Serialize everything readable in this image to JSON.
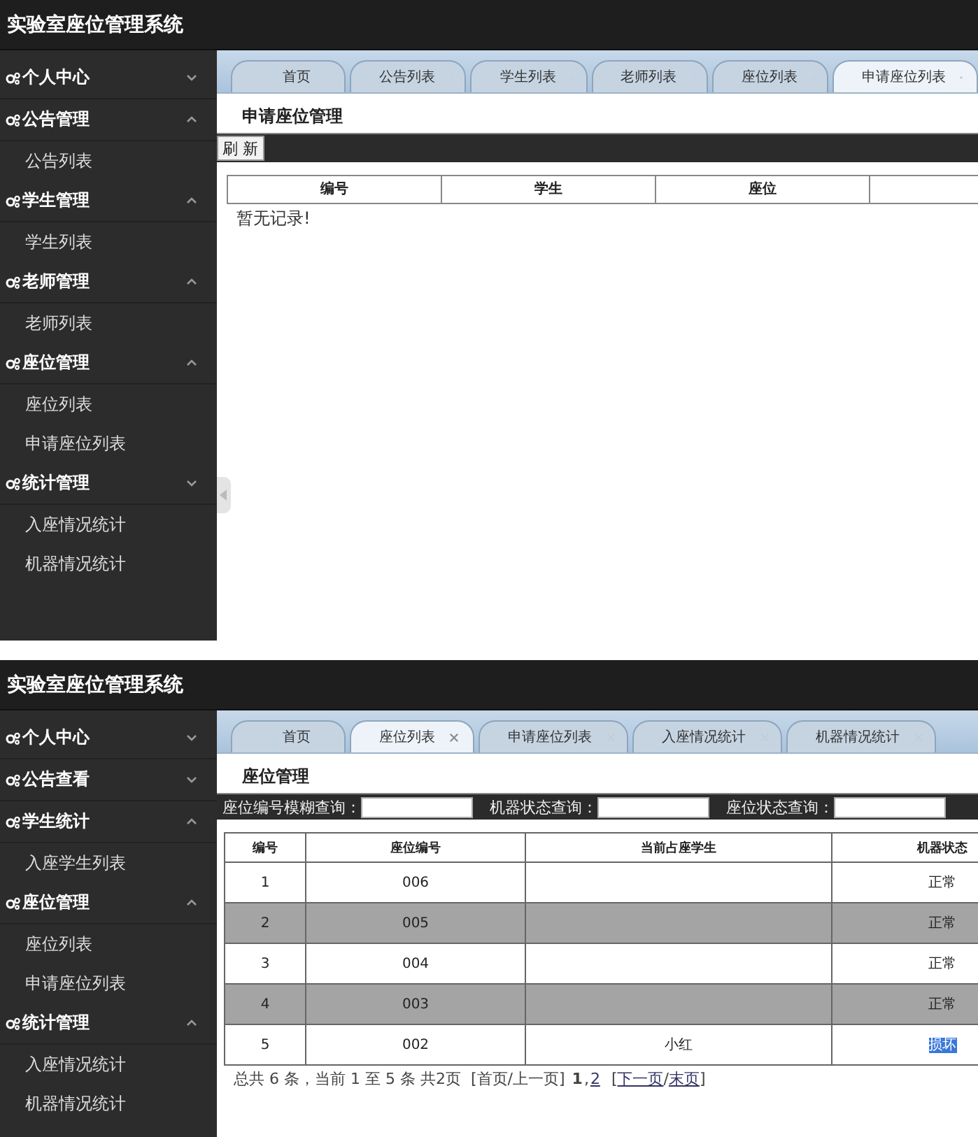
{
  "screens": [
    {
      "kind": "apply",
      "title": "实验室座位管理系统",
      "sidebar": [
        {
          "label": "个人中心",
          "expanded": false
        },
        {
          "label": "公告管理",
          "expanded": true,
          "children": [
            "公告列表"
          ]
        },
        {
          "label": "学生管理",
          "expanded": true,
          "children": [
            "学生列表"
          ]
        },
        {
          "label": "老师管理",
          "expanded": true,
          "children": [
            "老师列表"
          ]
        },
        {
          "label": "座位管理",
          "expanded": true,
          "children": [
            "座位列表",
            "申请座位列表"
          ]
        },
        {
          "label": "统计管理",
          "expanded": false,
          "children": [
            "入座情况统计",
            "机器情况统计"
          ]
        }
      ],
      "tabs": [
        {
          "label": "首页",
          "closable": false,
          "selected": false
        },
        {
          "label": "公告列表",
          "closable": true,
          "selected": false
        },
        {
          "label": "学生列表",
          "closable": true,
          "selected": false
        },
        {
          "label": "老师列表",
          "closable": true,
          "selected": false
        },
        {
          "label": "座位列表",
          "closable": true,
          "selected": false
        },
        {
          "label": "申请座位列表",
          "closable": true,
          "selected": true
        }
      ],
      "heading": "申请座位管理",
      "refresh_button": "刷 新",
      "columns": [
        "编号",
        "学生",
        "座位"
      ],
      "empty_message": "暂无记录!"
    },
    {
      "kind": "seats",
      "title": "实验室座位管理系统",
      "sidebar": [
        {
          "label": "个人中心",
          "expanded": false
        },
        {
          "label": "公告查看",
          "expanded": false
        },
        {
          "label": "学生统计",
          "expanded": true,
          "children": [
            "入座学生列表"
          ]
        },
        {
          "label": "座位管理",
          "expanded": true,
          "children": [
            "座位列表",
            "申请座位列表"
          ]
        },
        {
          "label": "统计管理",
          "expanded": true,
          "children": [
            "入座情况统计",
            "机器情况统计"
          ]
        }
      ],
      "tabs": [
        {
          "label": "首页",
          "closable": false,
          "selected": false
        },
        {
          "label": "座位列表",
          "closable": true,
          "selected": true
        },
        {
          "label": "申请座位列表",
          "closable": true,
          "selected": false
        },
        {
          "label": "入座情况统计",
          "closable": true,
          "selected": false
        },
        {
          "label": "机器情况统计",
          "closable": true,
          "selected": false
        }
      ],
      "heading": "座位管理",
      "filters": [
        "座位编号模糊查询：",
        "机器状态查询：",
        "座位状态查询："
      ],
      "columns": [
        "编号",
        "座位编号",
        "当前占座学生",
        "机器状态"
      ],
      "rows": [
        {
          "cells": [
            "1",
            "006",
            "",
            "正常"
          ],
          "shaded": false,
          "status_selected": false
        },
        {
          "cells": [
            "2",
            "005",
            "",
            "正常"
          ],
          "shaded": true,
          "status_selected": false
        },
        {
          "cells": [
            "3",
            "004",
            "",
            "正常"
          ],
          "shaded": false,
          "status_selected": false
        },
        {
          "cells": [
            "4",
            "003",
            "",
            "正常"
          ],
          "shaded": true,
          "status_selected": false
        },
        {
          "cells": [
            "5",
            "002",
            "小红",
            "损坏"
          ],
          "shaded": false,
          "status_selected": true
        }
      ],
      "pager": {
        "summary": "总共 6 条，当前 1 至 5 条 共2页",
        "prev": "[首页/上一页]",
        "pages": [
          {
            "label": "1",
            "current": true
          },
          {
            "label": "2",
            "current": false
          }
        ],
        "separator": ",",
        "next": [
          {
            "text": "[",
            "link": false
          },
          {
            "text": "下一页",
            "link": true
          },
          {
            "text": "/",
            "link": false
          },
          {
            "text": "末页",
            "link": true
          },
          {
            "text": "]",
            "link": false
          }
        ]
      }
    }
  ]
}
